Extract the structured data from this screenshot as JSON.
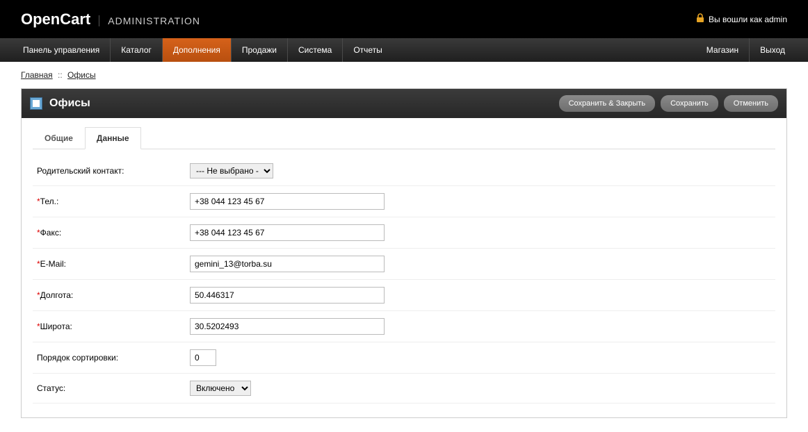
{
  "header": {
    "logo_main": "OpenCart",
    "logo_sub": "ADMINISTRATION",
    "login_text": "Вы вошли как admin"
  },
  "menu": {
    "items": [
      {
        "label": "Панель управления"
      },
      {
        "label": "Каталог"
      },
      {
        "label": "Дополнения"
      },
      {
        "label": "Продажи"
      },
      {
        "label": "Система"
      },
      {
        "label": "Отчеты"
      }
    ],
    "right": [
      {
        "label": "Магазин"
      },
      {
        "label": "Выход"
      }
    ]
  },
  "breadcrumb": {
    "home": "Главная",
    "sep": "::",
    "current": "Офисы"
  },
  "panel": {
    "title": "Офисы",
    "actions": {
      "save_close": "Сохранить & Закрыть",
      "save": "Сохранить",
      "cancel": "Отменить"
    }
  },
  "tabs": {
    "general": "Общие",
    "data": "Данные"
  },
  "form": {
    "parent_label": "Родительский контакт:",
    "parent_value": "--- Не выбрано ---",
    "tel_label": "Тел.:",
    "tel_value": "+38 044 123 45 67",
    "fax_label": "Факс:",
    "fax_value": "+38 044 123 45 67",
    "email_label": "E-Mail:",
    "email_value": "gemini_13@torba.su",
    "lon_label": "Долгота:",
    "lon_value": "50.446317",
    "lat_label": "Широта:",
    "lat_value": "30.5202493",
    "sort_label": "Порядок сортировки:",
    "sort_value": "0",
    "status_label": "Статус:",
    "status_value": "Включено"
  }
}
